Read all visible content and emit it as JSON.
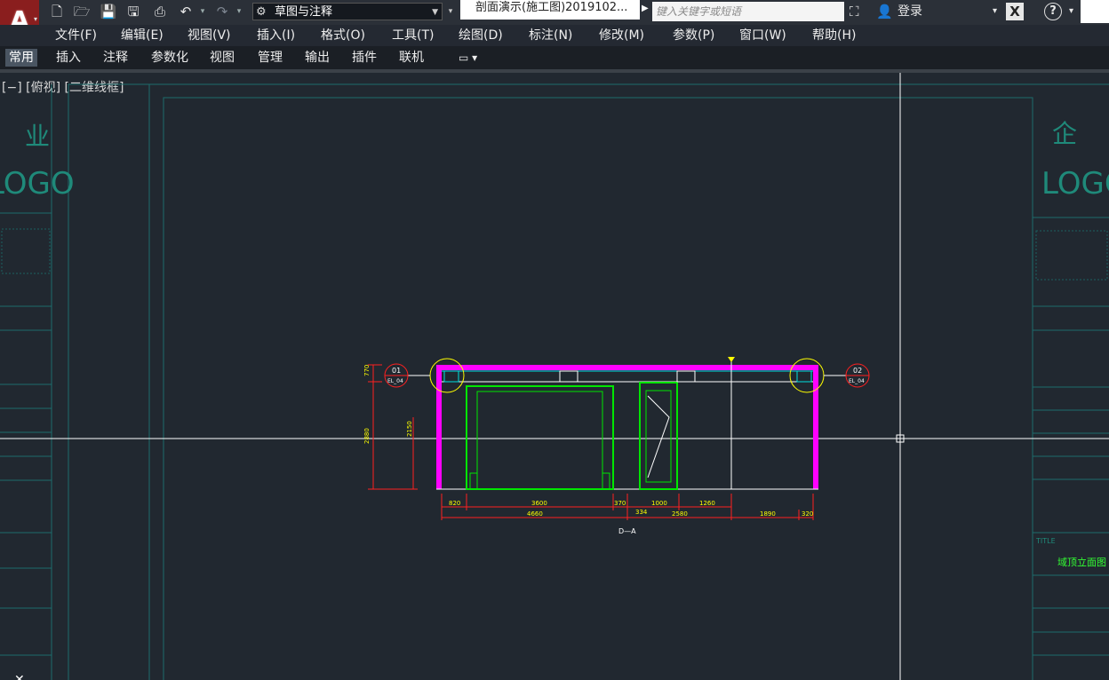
{
  "titlebar": {
    "workspace": "草图与注释",
    "document_title": "剖面演示(施工图)2019102...",
    "search_placeholder": "键入关键字或短语",
    "login": "登录"
  },
  "menu": [
    "文件(F)",
    "编辑(E)",
    "视图(V)",
    "插入(I)",
    "格式(O)",
    "工具(T)",
    "绘图(D)",
    "标注(N)",
    "修改(M)",
    "参数(P)",
    "窗口(W)",
    "帮助(H)"
  ],
  "ribbon_tabs": [
    "常用",
    "插入",
    "注释",
    "参数化",
    "视图",
    "管理",
    "输出",
    "插件",
    "联机"
  ],
  "viewport_label": "[−] [俯视] [二维线框]",
  "drawing": {
    "view_name": "D—A",
    "callout_left": {
      "id": "01",
      "sheet": "EL_04"
    },
    "callout_right": {
      "id": "02",
      "sheet": "EL_04"
    },
    "left_dims": [
      "770",
      "2880",
      "2150"
    ],
    "dims_row1": [
      "820",
      "3600",
      "370",
      "1000",
      "1260"
    ],
    "dims_row2": [
      "4660",
      "334",
      "2580",
      "1890",
      "320"
    ],
    "titleblock_left_logo": "LOGO",
    "titleblock_right_logo": "LOGO",
    "titleblock_right_chars": [
      "企",
      "LOGO"
    ],
    "sheet_title": "域顶立面图",
    "title_label": "TITLE"
  },
  "colors": {
    "magenta": "#ff00ff",
    "green": "#00e600",
    "yellow": "#ffff00",
    "red": "#ff2020",
    "frame": "#1d6c6c",
    "white": "#ffffff"
  }
}
